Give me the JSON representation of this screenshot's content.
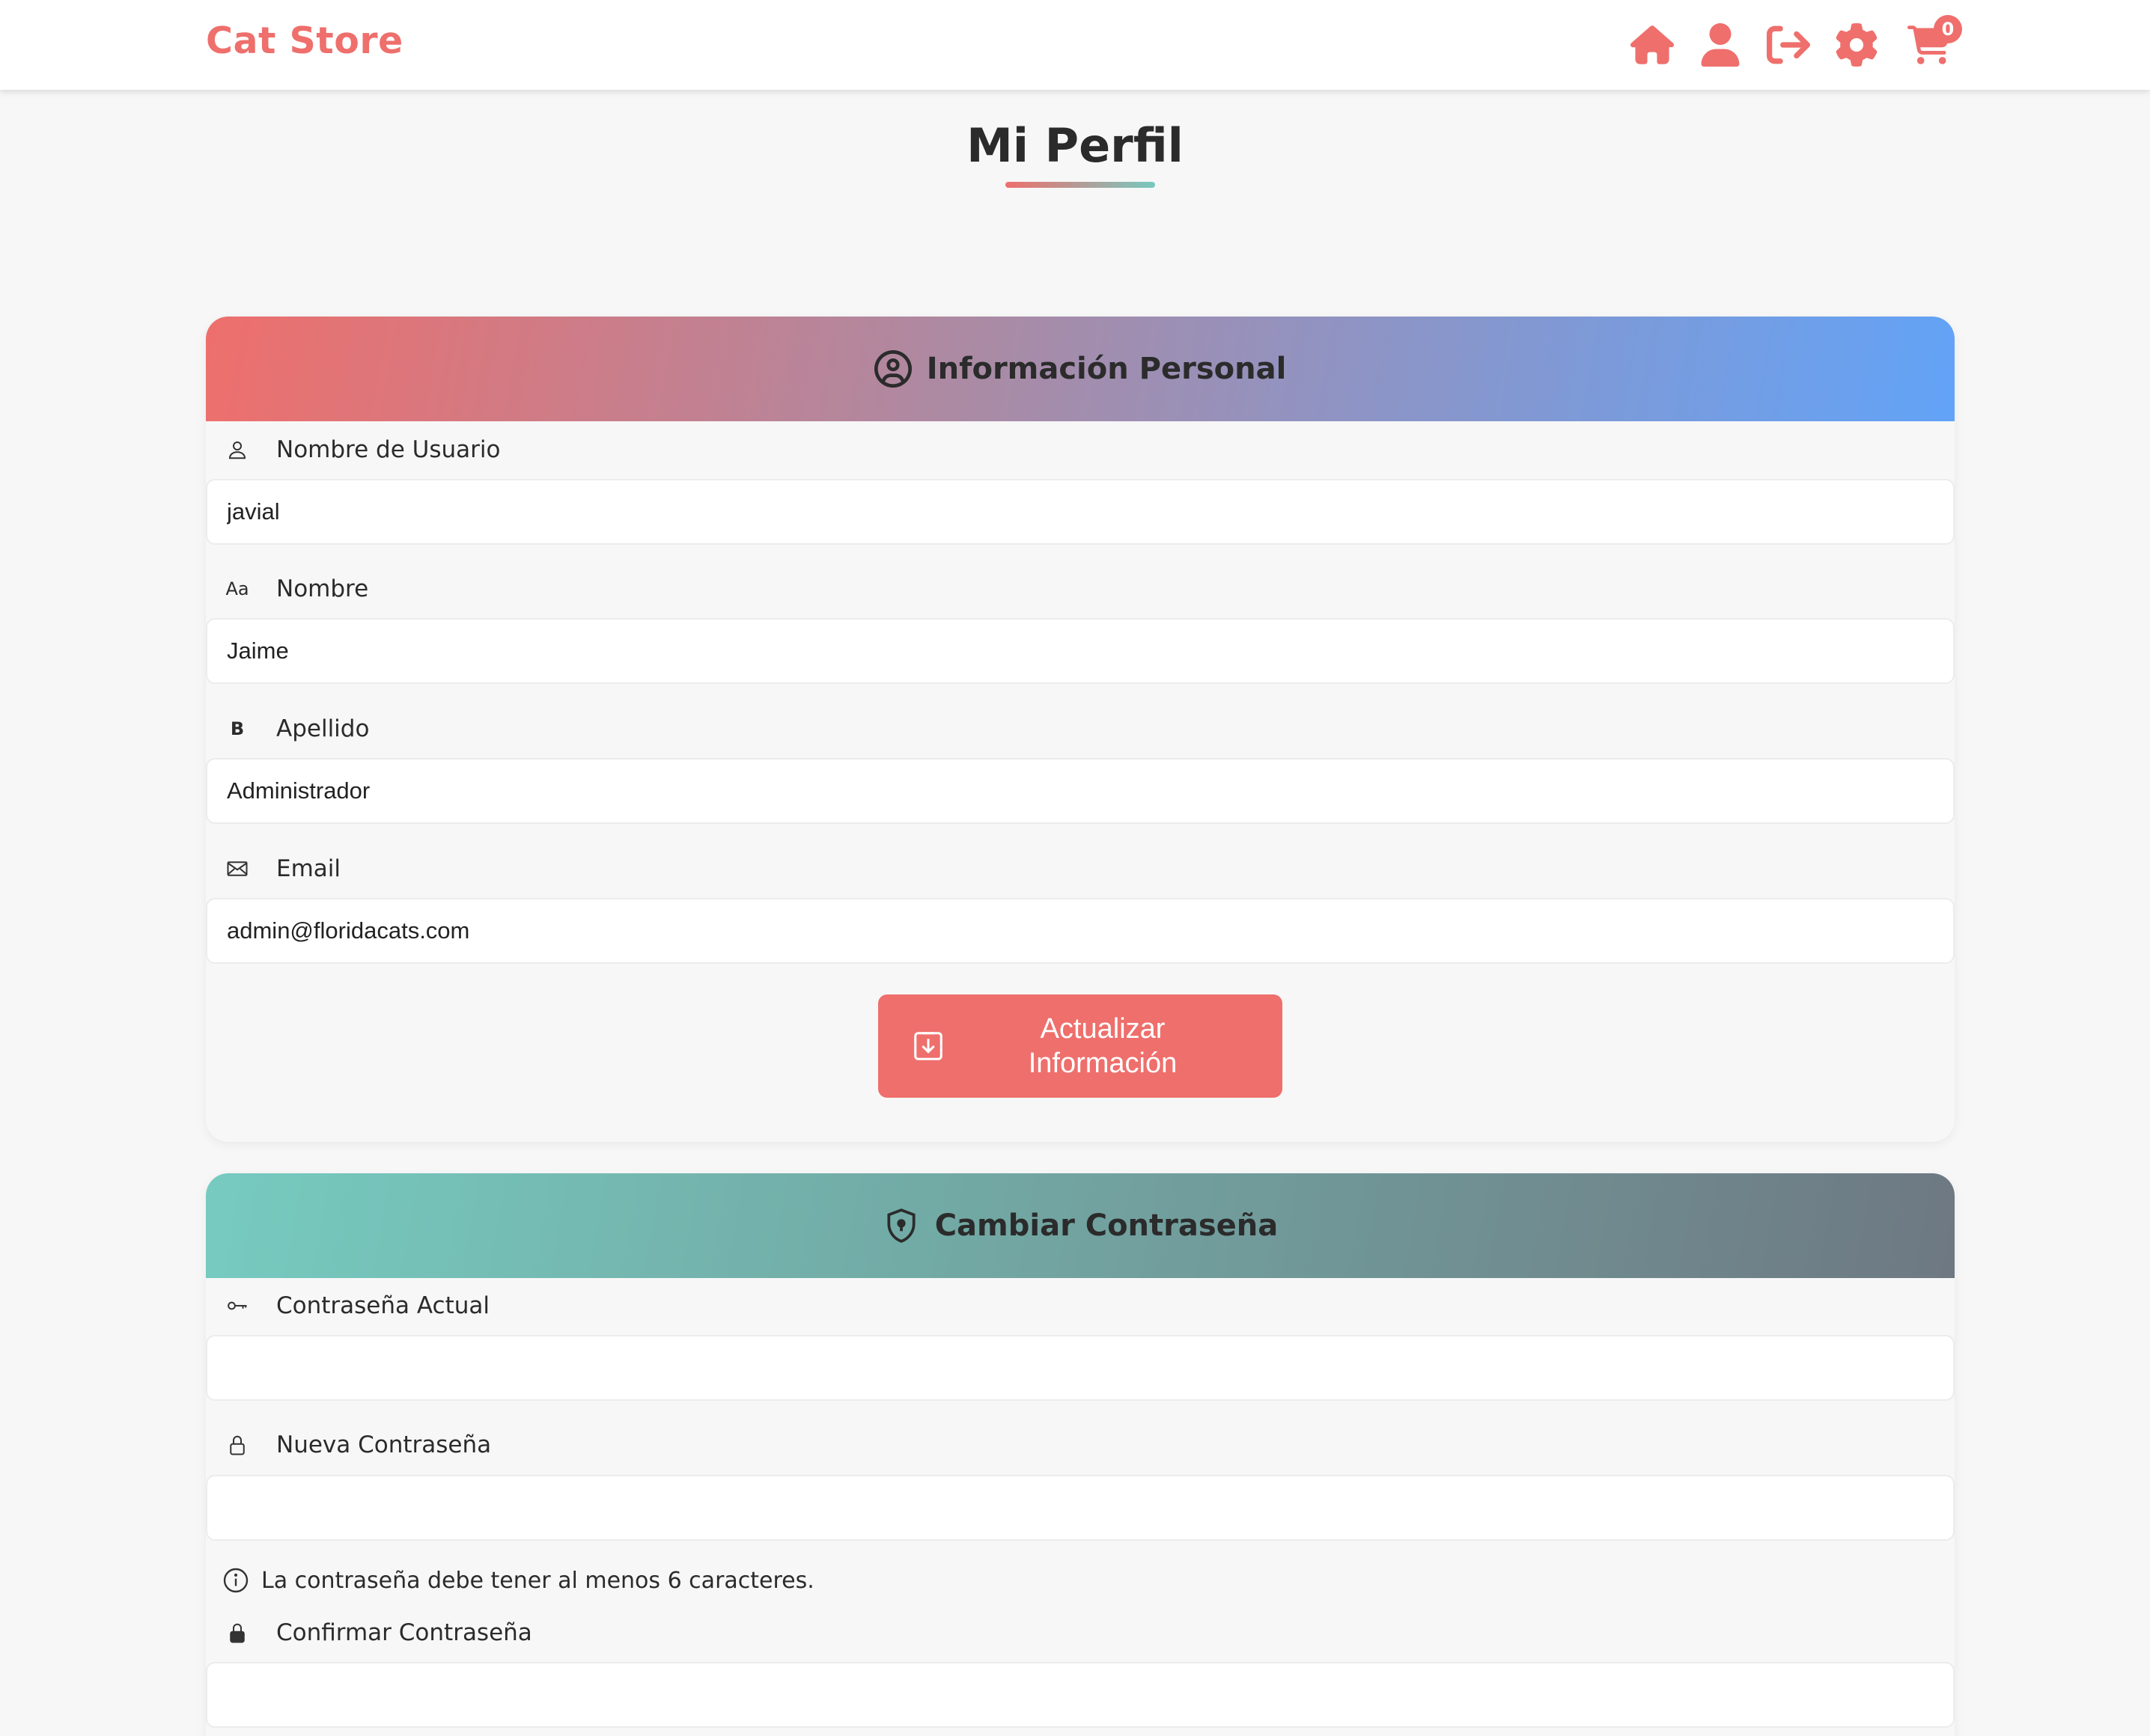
{
  "navbar": {
    "brand": "Cat Store",
    "icons": [
      "home-icon",
      "user-icon",
      "logout-icon",
      "settings-icon",
      "cart-icon"
    ],
    "cart_count": "0"
  },
  "page": {
    "title": "Mi Perfil"
  },
  "personal_info": {
    "header": "Información Personal",
    "fields": [
      {
        "label": "Nombre de Usuario",
        "icon": "user-outline-icon",
        "value": "javial"
      },
      {
        "label": "Nombre",
        "icon": "text-aa-icon",
        "icon_text": "Aa",
        "value": "Jaime"
      },
      {
        "label": "Apellido",
        "icon": "bold-b-icon",
        "icon_text": "B",
        "value": "Administrador"
      },
      {
        "label": "Email",
        "icon": "envelope-icon",
        "value": "admin@floridacats.com"
      }
    ],
    "submit_label": "Actualizar\nInformación"
  },
  "change_password": {
    "header": "Cambiar Contraseña",
    "fields": [
      {
        "label": "Contraseña Actual",
        "icon": "key-icon",
        "value": ""
      },
      {
        "label": "Nueva Contraseña",
        "icon": "lock-open-icon",
        "value": ""
      },
      {
        "label": "Confirmar Contraseña",
        "icon": "lock-closed-icon",
        "value": ""
      }
    ],
    "hint": "La contraseña debe tener al menos 6 caracteres."
  },
  "colors": {
    "accent": "#ee6f6c",
    "teal": "#77c9c0",
    "blue": "#62a3f7",
    "slate": "#6e7882"
  }
}
